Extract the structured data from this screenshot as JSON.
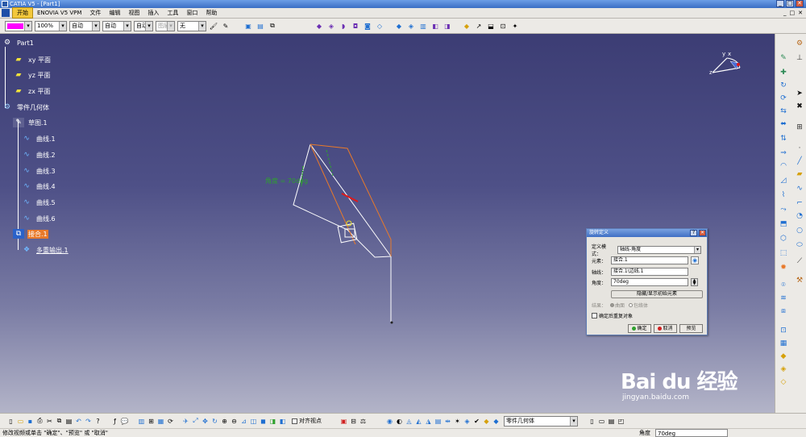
{
  "window": {
    "title": "CATIA V5 - [Part1]",
    "buttons": [
      "_",
      "□",
      "✕"
    ]
  },
  "menu": {
    "items": [
      "开始",
      "ENOVIA V5 VPM",
      "文件",
      "编辑",
      "视图",
      "插入",
      "工具",
      "窗口",
      "帮助"
    ],
    "active": "开始",
    "right_buttons": [
      "_",
      "□",
      "✕"
    ]
  },
  "toolbar_top": {
    "color": "#ff00ff",
    "transparency": "100%",
    "line_thickness": "自动",
    "line_type": "自动",
    "point_symbol": "自动",
    "layer_prefix": "图层",
    "layer": "无"
  },
  "tree": {
    "root": "Part1",
    "planes": [
      "xy 平面",
      "yz 平面",
      "zx 平面"
    ],
    "body": "零件几何体",
    "children": [
      "草图.1",
      "曲线.1",
      "曲线.2",
      "曲线.3",
      "曲线.4",
      "曲线.5",
      "曲线.6",
      "接合.1",
      "多重输出.1"
    ],
    "selected": "接合.1"
  },
  "viewport": {
    "dimension_label": "角度 = 70deg",
    "compass_axes": [
      "y",
      "x",
      "z"
    ]
  },
  "dialog": {
    "title": "旋转定义",
    "title_buttons": [
      "?",
      "✕"
    ],
    "type_label": "定义模式：",
    "type_value": "轴线-角度",
    "element_label": "元素：",
    "element_value": "接合.1",
    "axis_label": "轴线：",
    "axis_value": "接合.1\\边线.1",
    "angle_label": "角度：",
    "angle_value": "70deg",
    "hide_show_button": "隐藏/显示初始元素",
    "result_label": "结果：",
    "result_options": [
      "曲面",
      "包络体"
    ],
    "checkbox_label": "确定后重复对象",
    "ok": "确定",
    "cancel": "取消",
    "preview": "预览"
  },
  "toolbar_bottom": {
    "snap_label": "对齐视点",
    "body_select": "零件几何体"
  },
  "status": {
    "message": "修改视频或单击 \"确定\"、\"预览\" 或 \"取消\"",
    "field_label": "角度",
    "field_value": "70deg"
  },
  "watermark": {
    "brand": "Bai du 经验",
    "url": "jingyan.baidu.com"
  },
  "colors": {
    "accent": "#e8792a",
    "background_top": "#3c3d74",
    "selection": "#e8792a",
    "dimension": "#2ea12e"
  }
}
